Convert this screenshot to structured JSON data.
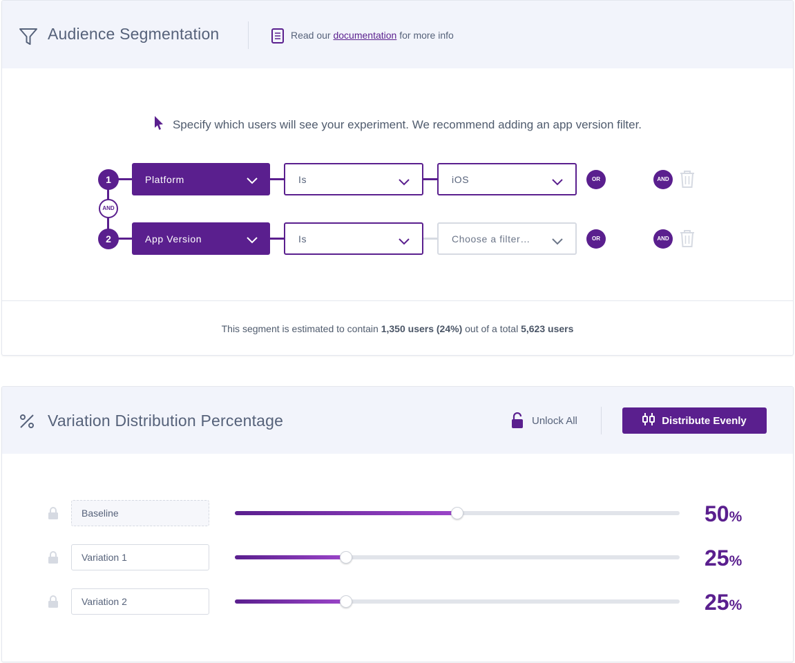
{
  "segmentation": {
    "title": "Audience Segmentation",
    "doc_prefix": "Read our ",
    "doc_link": "documentation",
    "doc_suffix": " for more info",
    "hint": "Specify which users will see your experiment. We recommend adding an app version filter.",
    "and_connector": "AND",
    "rules": [
      {
        "number": "1",
        "field": "Platform",
        "operator": "Is",
        "value": "iOS",
        "or_label": "OR",
        "and_label": "AND"
      },
      {
        "number": "2",
        "field": "App Version",
        "operator": "Is",
        "value_placeholder": "Choose a filter…",
        "or_label": "OR",
        "and_label": "AND"
      }
    ],
    "estimate": {
      "prefix": "This segment is estimated to contain ",
      "users": "1,350 users (24%)",
      "middle": " out of a total ",
      "total": "5,623 users"
    }
  },
  "distribution": {
    "title": "Variation Distribution Percentage",
    "unlock_label": "Unlock All",
    "distribute_label": "Distribute Evenly",
    "variations": [
      {
        "name": "Baseline",
        "percent": "50",
        "value": 0.5
      },
      {
        "name": "Variation 1",
        "percent": "25",
        "value": 0.25
      },
      {
        "name": "Variation 2",
        "percent": "25",
        "value": 0.25
      }
    ],
    "percent_symbol": "%"
  },
  "colors": {
    "accent": "#5a1f8e",
    "header_bg": "#f2f4fb"
  }
}
